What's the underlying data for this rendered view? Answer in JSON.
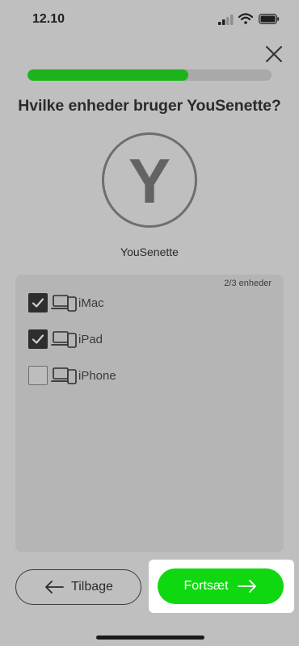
{
  "status_bar": {
    "time": "12.10"
  },
  "progress": {
    "fraction": 0.66
  },
  "title": "Hvilke enheder bruger YouSenette?",
  "profile": {
    "initial": "Y",
    "name": "YouSenette"
  },
  "devices": {
    "count_label": "2/3 enheder",
    "items": [
      {
        "label": "iMac",
        "checked": true
      },
      {
        "label": "iPad",
        "checked": true
      },
      {
        "label": "iPhone",
        "checked": false
      }
    ]
  },
  "footer": {
    "back_label": "Tilbage",
    "continue_label": "Fortsæt"
  },
  "colors": {
    "accent": "#10d810",
    "progress": "#1db31d",
    "background": "#bfbfbf"
  }
}
